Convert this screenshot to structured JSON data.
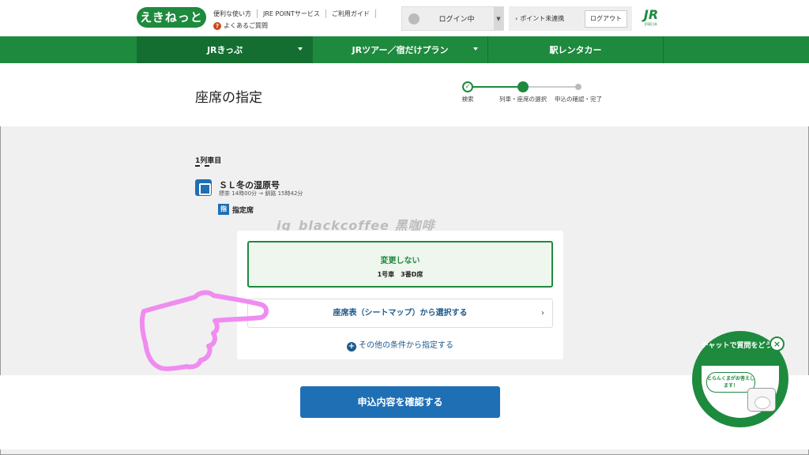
{
  "header": {
    "logo_text": "えきねっと",
    "links": [
      "便利な使い方",
      "JRE POINTサービス",
      "ご利用ガイド"
    ],
    "faq_label": "よくあるご質問",
    "login_label": "ログイン中",
    "points_label": "ポイント未連携",
    "logout_label": "ログアウト",
    "jr_logo": "JR",
    "jr_logo_sub": "JR東日本"
  },
  "nav": {
    "tabs": [
      {
        "label": "JRきっぷ"
      },
      {
        "label": "JRツアー／宿だけプラン"
      },
      {
        "label": "駅レンタカー"
      }
    ]
  },
  "page": {
    "title": "座席の指定",
    "steps": [
      {
        "label": "検索"
      },
      {
        "label": "列車・座席の選択"
      },
      {
        "label": "申込の確認・完了"
      }
    ]
  },
  "train": {
    "number_label": "1列車目",
    "name": "ＳＬ冬の湿原号",
    "time": "標茶 14時00分 → 釧路 15時42分",
    "seat_badge": "指",
    "seat_type": "指定席"
  },
  "watermark": "ig_blackcoffee  黑咖啡",
  "options": {
    "keep_title": "変更しない",
    "keep_detail": "1号車　3番D席",
    "seatmap_label": "座席表（シートマップ）から選択する",
    "other_label": "その他の条件から指定する"
  },
  "confirm_label": "申込内容を確認する",
  "chat": {
    "title": "チャットで質問をどうぞ",
    "speech": "とらんくまがお答えします！"
  }
}
